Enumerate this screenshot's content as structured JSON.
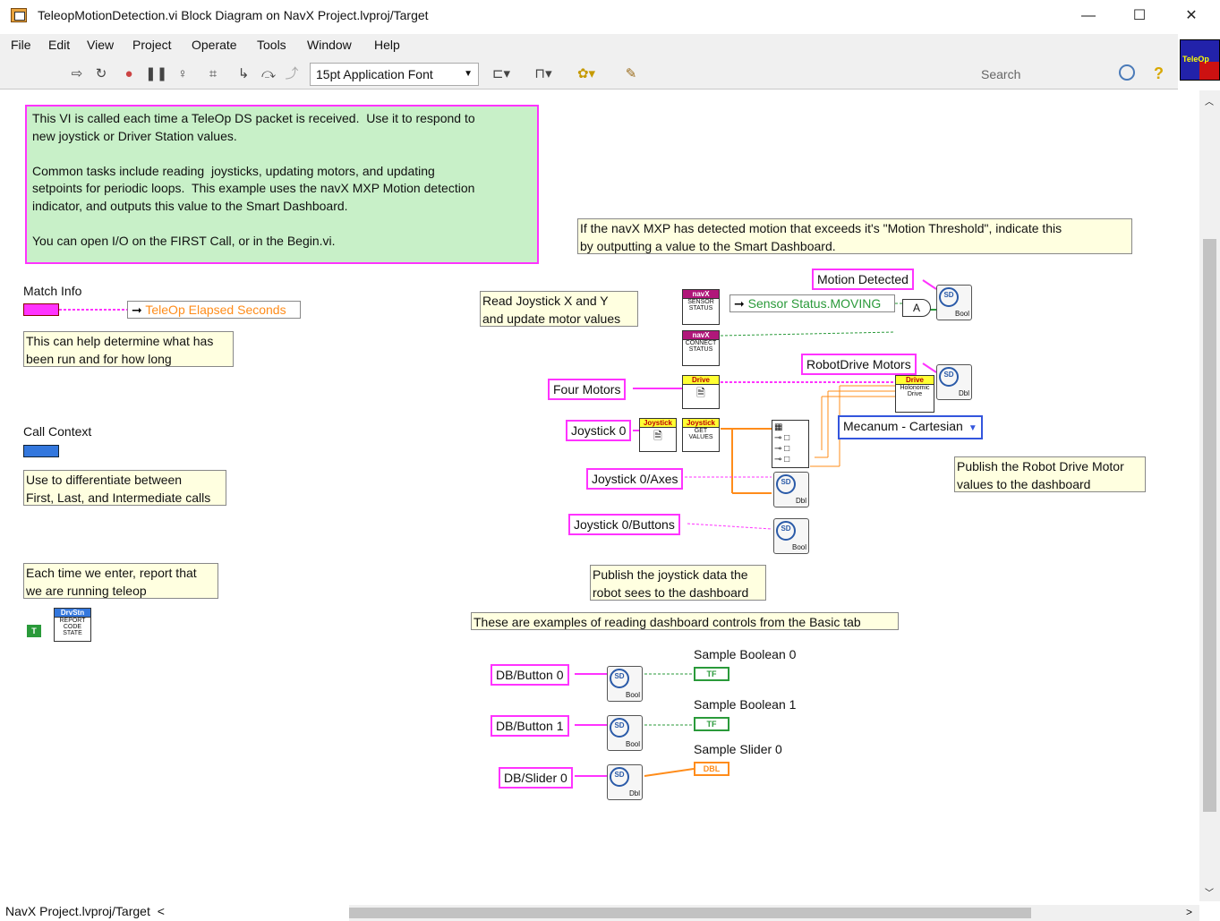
{
  "window": {
    "title": "TeleopMotionDetection.vi Block Diagram on NavX Project.lvproj/Target",
    "minimize": "—",
    "maximize": "☐",
    "close": "✕"
  },
  "menu": [
    "File",
    "Edit",
    "View",
    "Project",
    "Operate",
    "Tools",
    "Window",
    "Help"
  ],
  "toolbar": {
    "font": "15pt Application Font",
    "search_placeholder": "Search",
    "vi_icon_label": "TeleOp"
  },
  "comments": {
    "main": "This VI is called each time a TeleOp DS packet is received.  Use it to respond to\nnew joystick or Driver Station values.\n\nCommon tasks include reading  joysticks, updating motors, and updating\nsetpoints for periodic loops.  This example uses the navX MXP Motion detection\nindicator, and outputs this value to the Smart Dashboard.\n\nYou can open I/O on the FIRST Call, or in the Begin.vi.",
    "motion": "If the navX MXP has detected motion that exceeds it's \"Motion Threshold\", indicate this\nby outputting a value to the Smart Dashboard.",
    "match_help": "This can help determine what has\nbeen run and for how long",
    "call_help": "Use to differentiate between\nFirst, Last, and Intermediate calls",
    "teleop_help": "Each time we enter, report that\nwe are running teleop",
    "read_joystick": "Read Joystick X and Y\nand update motor values",
    "publish_motor": "Publish the Robot Drive Motor\nvalues to the dashboard",
    "publish_joystick": "Publish the joystick data the\nrobot sees to the dashboard",
    "examples": "These are examples of reading dashboard controls from the Basic tab"
  },
  "labels": {
    "match_info": "Match Info",
    "call_context": "Call Context",
    "teleop_elapsed": "TeleOp Elapsed Seconds",
    "sensor_status": "Sensor Status.MOVING",
    "mecanum": "Mecanum - Cartesian",
    "sample_bool0": "Sample Boolean 0",
    "sample_bool1": "Sample Boolean 1",
    "sample_slider0": "Sample Slider 0"
  },
  "strings": {
    "motion_detected": "Motion Detected",
    "robotdrive_motors": "RobotDrive Motors",
    "four_motors": "Four Motors",
    "joystick0": "Joystick 0",
    "joystick0_axes": "Joystick 0/Axes",
    "joystick0_buttons": "Joystick 0/Buttons",
    "db_button0": "DB/Button 0",
    "db_button1": "DB/Button 1",
    "db_slider0": "DB/Slider 0"
  },
  "nodes": {
    "navx1_hdr": "navX",
    "navx1_body": "SENSOR STATUS",
    "navx2_hdr": "navX",
    "navx2_body": "CONNECT STATUS",
    "drive_hdr": "Drive",
    "drive2_hdr": "Drive",
    "drive2_body": "Holonomic Drive",
    "joy1_hdr": "Joystick",
    "joy2_hdr": "Joystick",
    "joy2_body": "GET VALUES",
    "ds_hdr": "DrvStn",
    "ds_body": "REPORT CODE STATE",
    "and": "A",
    "bool": "Bool",
    "dbl": "Dbl",
    "tf": "TF",
    "dbl_ind": "DBL",
    "true_const": "T"
  },
  "status": {
    "path": "NavX Project.lvproj/Target"
  }
}
